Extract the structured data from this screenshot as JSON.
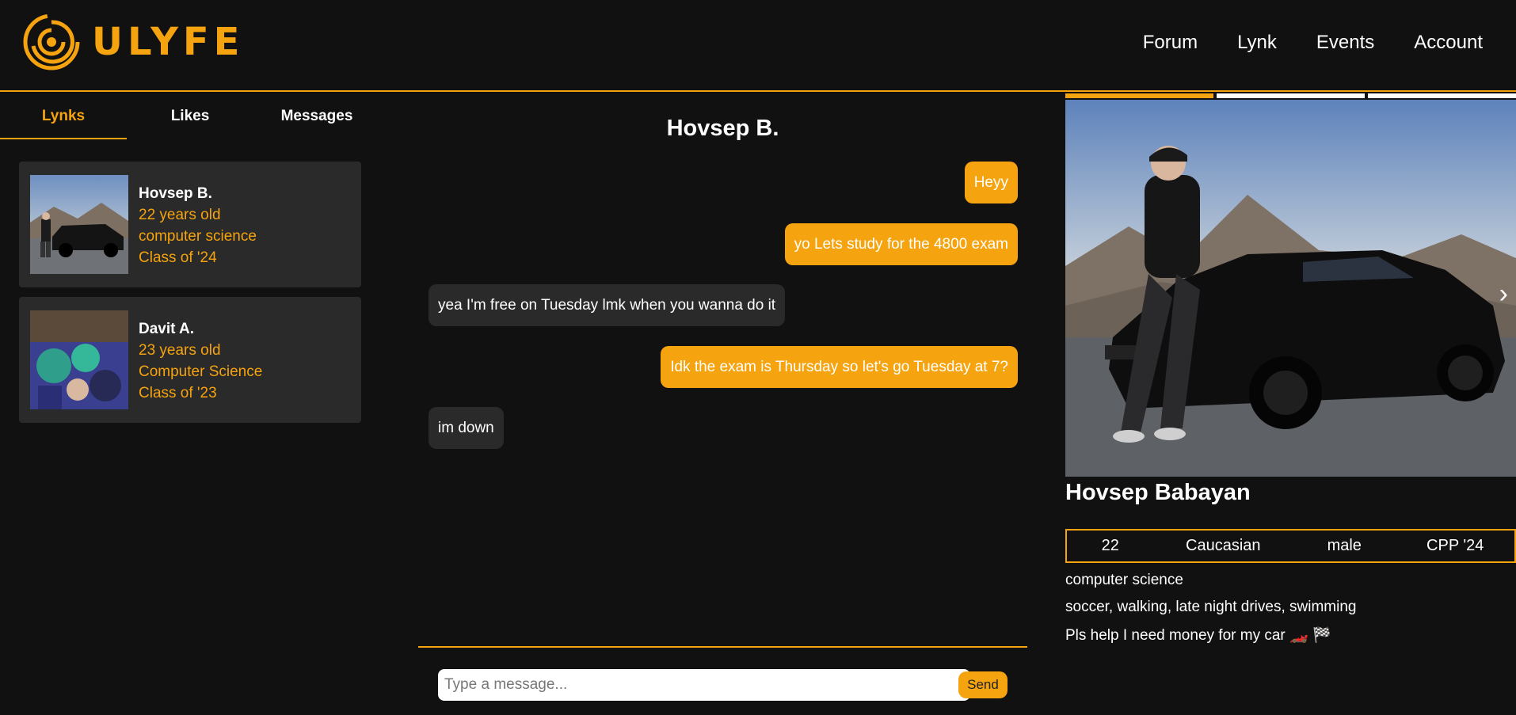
{
  "header": {
    "logo_text": "ULYFE",
    "nav": [
      "Forum",
      "Lynk",
      "Events",
      "Account"
    ]
  },
  "tabs": [
    "Lynks",
    "Likes",
    "Messages"
  ],
  "lynks": [
    {
      "name": "Hovsep B.",
      "age": "22 years old",
      "major": "computer science",
      "class": "Class of '24"
    },
    {
      "name": "Davit A.",
      "age": "23 years old",
      "major": "Computer Science",
      "class": "Class of '23"
    }
  ],
  "chat": {
    "title": "Hovsep B.",
    "messages": [
      {
        "text": "Heyy",
        "from": "me"
      },
      {
        "text": "yo Lets study for the 4800 exam",
        "from": "me"
      },
      {
        "text": "yea I'm free on Tuesday lmk when you wanna do it",
        "from": "them"
      },
      {
        "text": "Idk the exam is Thursday so let's go Tuesday at 7?",
        "from": "me"
      },
      {
        "text": "im down",
        "from": "them"
      }
    ],
    "input_placeholder": "Type a message...",
    "send_label": "Send"
  },
  "profile": {
    "full_name": "Hovsep Babayan",
    "stats": [
      "22",
      "Caucasian",
      "male",
      "CPP '24"
    ],
    "major": "computer science",
    "interests": "soccer, walking, late night drives, swimming",
    "bio": "Pls help I need money for my car 🏎️ 🏁",
    "next_arrow": "›"
  },
  "colors": {
    "accent": "#f5a30e",
    "background": "#111111",
    "card": "#2a2a2a"
  }
}
